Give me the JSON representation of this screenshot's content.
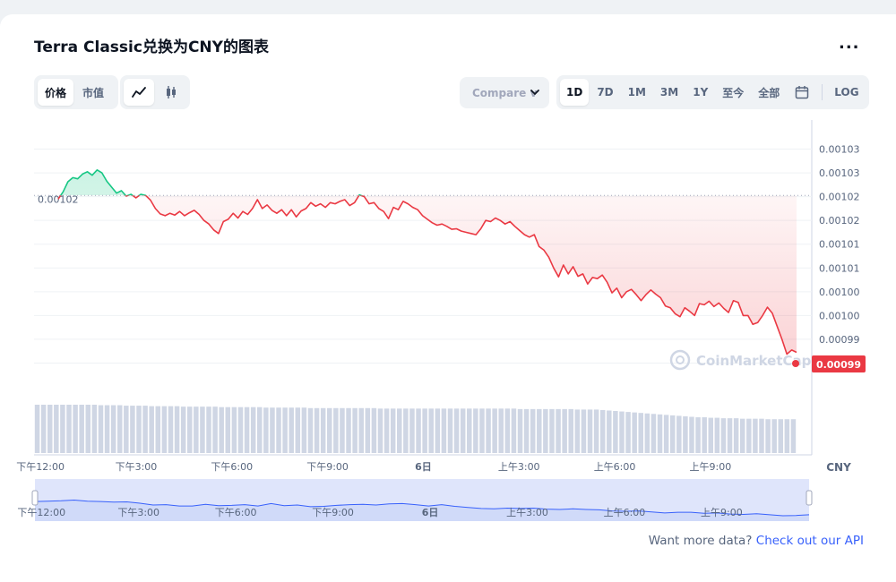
{
  "page": {
    "title": "Terra Classic兑换为CNY的图表",
    "more_label": "...",
    "compare_label": "Compare v",
    "type_tabs": [
      {
        "label": "价格",
        "active": true
      },
      {
        "label": "市值",
        "active": false
      }
    ],
    "range_tabs": [
      {
        "label": "1D",
        "active": true
      },
      {
        "label": "7D",
        "active": false
      },
      {
        "label": "1M",
        "active": false
      },
      {
        "label": "3M",
        "active": false
      },
      {
        "label": "1Y",
        "active": false
      },
      {
        "label": "至今",
        "active": false
      },
      {
        "label": "全部",
        "active": false
      }
    ],
    "log_label": "LOG",
    "footer_text": "Want more data?",
    "footer_link": "Check out our API",
    "watermark": "CoinMarketCap",
    "colors": {
      "up": "#16c784",
      "down": "#ea3943",
      "grid": "#eff2f5",
      "volume": "#cfd6e4",
      "navigator_fill": "#dfe5fb",
      "navigator_line": "#3861fb"
    }
  },
  "chart_data": {
    "type": "line",
    "title": "Terra Classic兑换为CNY的图表",
    "currency": "CNY",
    "y_ticks": [
      "0.00103",
      "0.00103",
      "0.00102",
      "0.00102",
      "0.00101",
      "0.00101",
      "0.00100",
      "0.00100",
      "0.00099",
      "0.00099"
    ],
    "y_tick_values": [
      0.001034,
      0.00103,
      0.001026,
      0.001022,
      0.001018,
      0.001014,
      0.00101,
      0.001006,
      0.001002,
      0.000998
    ],
    "ylim": [
      0.000994,
      0.001038
    ],
    "x_ticks": [
      "下午12:00",
      "下午3:00",
      "下午6:00",
      "下午9:00",
      "6日",
      "上午3:00",
      "上午6:00",
      "上午9:00"
    ],
    "x_tick_hours": [
      12,
      15,
      18,
      21,
      24,
      27,
      30,
      33
    ],
    "x_start_hour": 11.8,
    "x_end_hour": 35.7,
    "baseline_value": 0.0010262,
    "baseline_label": "0.00102",
    "last_value_label": "0.00099",
    "series": [
      {
        "values": [
          0.0010256,
          0.0010268,
          0.0010285,
          0.0010292,
          0.001029,
          0.0010298,
          0.0010302,
          0.0010296,
          0.0010305,
          0.00103,
          0.0010286,
          0.0010276,
          0.0010266,
          0.001027,
          0.0010261,
          0.0010264,
          0.0010258,
          0.0010264,
          0.0010262,
          0.0010254,
          0.001024,
          0.0010231,
          0.0010228,
          0.0010232,
          0.0010229,
          0.0010235,
          0.0010228,
          0.0010233,
          0.0010237,
          0.001023,
          0.001022,
          0.0010214,
          0.0010204,
          0.0010198,
          0.0010218,
          0.0010222,
          0.0010232,
          0.0010224,
          0.0010235,
          0.001023,
          0.001024,
          0.0010255,
          0.001024,
          0.0010246,
          0.0010237,
          0.0010232,
          0.0010238,
          0.0010228,
          0.0010238,
          0.0010226,
          0.0010236,
          0.001024,
          0.001025,
          0.0010244,
          0.0010248,
          0.0010242,
          0.001025,
          0.0010248,
          0.0010252,
          0.0010255,
          0.0010245,
          0.001025,
          0.0010263,
          0.001026,
          0.0010248,
          0.001025,
          0.001024,
          0.0010235,
          0.0010223,
          0.0010242,
          0.0010238,
          0.0010252,
          0.0010248,
          0.0010242,
          0.0010238,
          0.0010228,
          0.0010222,
          0.0010216,
          0.0010212,
          0.0010214,
          0.001021,
          0.0010205,
          0.0010206,
          0.0010202,
          0.00102,
          0.0010198,
          0.0010196,
          0.0010206,
          0.001022,
          0.0010218,
          0.0010224,
          0.001022,
          0.0010214,
          0.0010218,
          0.001021,
          0.0010203,
          0.0010196,
          0.0010192,
          0.0010196,
          0.0010176,
          0.001017,
          0.0010158,
          0.001014,
          0.0010125,
          0.0010145,
          0.001013,
          0.0010142,
          0.0010126,
          0.001013,
          0.0010113,
          0.0010124,
          0.0010122,
          0.0010128,
          0.0010116,
          0.0010098,
          0.0010106,
          0.001009,
          0.00101,
          0.0010104,
          0.0010095,
          0.0010085,
          0.0010095,
          0.0010103,
          0.0010096,
          0.001009,
          0.0010076,
          0.0010073,
          0.0010063,
          0.0010058,
          0.0010073,
          0.0010067,
          0.001006,
          0.001008,
          0.0010078,
          0.0010084,
          0.0010075,
          0.0010081,
          0.0010072,
          0.0010065,
          0.0010085,
          0.0010082,
          0.001006,
          0.001006,
          0.0010045,
          0.0010048,
          0.001006,
          0.0010074,
          0.0010064,
          0.0010042,
          0.001002,
          0.0009995,
          0.0010002,
          0.0009998
        ]
      }
    ],
    "volume_level": [
      1.0,
      1.0,
      1.0,
      1.0,
      1.0,
      1.0,
      1.0,
      1.0,
      1.0,
      1.0,
      0.99,
      0.99,
      0.99,
      0.99,
      0.98,
      0.98,
      0.98,
      0.98,
      0.97,
      0.97,
      0.97,
      0.97,
      0.97,
      0.96,
      0.96,
      0.96,
      0.96,
      0.96,
      0.96,
      0.95,
      0.95,
      0.95,
      0.95,
      0.95,
      0.95,
      0.95,
      0.94,
      0.94,
      0.94,
      0.94,
      0.94,
      0.94,
      0.94,
      0.93,
      0.93,
      0.93,
      0.93,
      0.93,
      0.93,
      0.93,
      0.93,
      0.93,
      0.93,
      0.93,
      0.92,
      0.92,
      0.92,
      0.92,
      0.92,
      0.92,
      0.92,
      0.92,
      0.92,
      0.92,
      0.92,
      0.92,
      0.92,
      0.92,
      0.92,
      0.92,
      0.92,
      0.92,
      0.92,
      0.92,
      0.92,
      0.92,
      0.91,
      0.91,
      0.91,
      0.91,
      0.91,
      0.91,
      0.91,
      0.91,
      0.91,
      0.9,
      0.9,
      0.9,
      0.9,
      0.89,
      0.88,
      0.87,
      0.86,
      0.85,
      0.84,
      0.83,
      0.82,
      0.81,
      0.8,
      0.79,
      0.78,
      0.77,
      0.76,
      0.75,
      0.74,
      0.74,
      0.73,
      0.73,
      0.72,
      0.72,
      0.72,
      0.71,
      0.71,
      0.71,
      0.71,
      0.7,
      0.7,
      0.7,
      0.7,
      0.7
    ],
    "navigator_values": [
      0.46,
      0.47,
      0.48,
      0.5,
      0.47,
      0.46,
      0.44,
      0.45,
      0.41,
      0.36,
      0.37,
      0.33,
      0.33,
      0.38,
      0.34,
      0.35,
      0.37,
      0.33,
      0.4,
      0.34,
      0.36,
      0.31,
      0.32,
      0.35,
      0.37,
      0.38,
      0.36,
      0.39,
      0.4,
      0.37,
      0.33,
      0.37,
      0.32,
      0.29,
      0.26,
      0.25,
      0.27,
      0.26,
      0.27,
      0.24,
      0.23,
      0.25,
      0.23,
      0.22,
      0.19,
      0.18,
      0.19,
      0.16,
      0.13,
      0.15,
      0.15,
      0.12,
      0.13,
      0.1,
      0.09,
      0.11,
      0.08,
      0.05,
      0.06,
      0.08
    ],
    "legend": "none",
    "grid": true
  }
}
